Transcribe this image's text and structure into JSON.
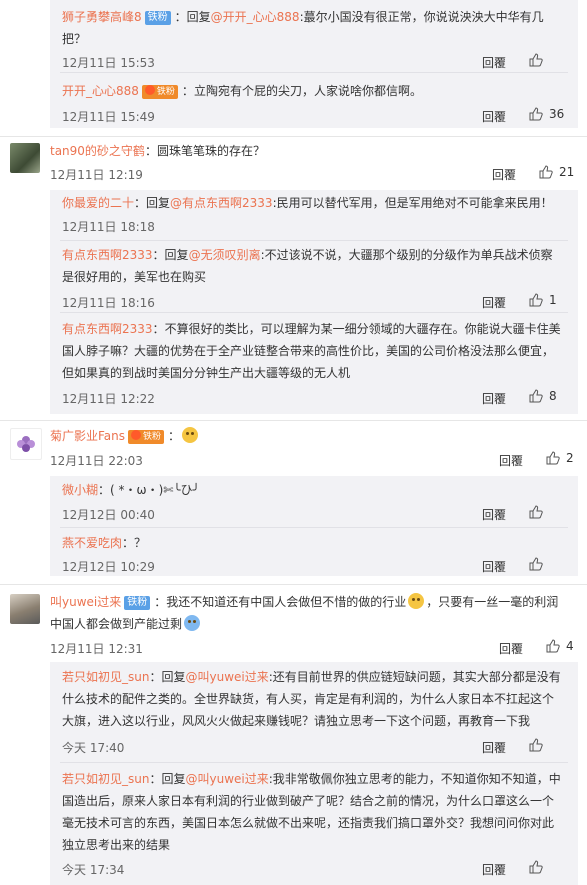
{
  "ui": {
    "reply_label": "回覆",
    "like_icon": "thumbs-up-icon"
  },
  "threads": [
    {
      "replies": [
        {
          "user": "狮子勇攀高峰8",
          "badge": "铁粉",
          "prefix": "：回复",
          "mention": "@开开_心心888",
          "text": ":蕞尔小国没有很正常，你说说泱泱大中华有几把？",
          "time": "12月11日 15:53",
          "likes": ""
        },
        {
          "user": "开开_心心888",
          "badge": "铁粉",
          "prefix": "：",
          "mention": "",
          "text": "立陶宛有个屁的尖刀，人家说啥你都信啊。",
          "time": "12月11日 15:49",
          "likes": "36"
        }
      ]
    },
    {
      "main": {
        "user": "tan90的砂之守鹤",
        "text": "：圆珠笔笔珠的存在？",
        "time": "12月11日 12:19",
        "likes": "21"
      },
      "replies": [
        {
          "user": "你最爱的二十",
          "prefix": "：回复",
          "mention": "@有点东西啊2333",
          "text": ":民用可以替代军用，但是军用绝对不可能拿来民用！",
          "time": "12月11日 18:18",
          "likes": ""
        },
        {
          "user": "有点东西啊2333",
          "prefix": "：回复",
          "mention": "@无须叹别离",
          "text": ":不过该说不说，大疆那个级别的分级作为单兵战术侦察是很好用的，美军也在购买",
          "time": "12月11日 18:16",
          "likes": "1"
        },
        {
          "user": "有点东西啊2333",
          "prefix": "：",
          "mention": "",
          "text": "不算很好的类比，可以理解为某一细分领域的大疆存在。你能说大疆卡住美国人脖子嘛？大疆的优势在于全产业链整合带来的高性价比，美国的公司价格没法那么便宜，但如果真的到战时美国分分钟生产出大疆等级的无人机",
          "time": "12月11日 12:22",
          "likes": "8"
        }
      ]
    },
    {
      "main": {
        "user": "菊广影业Fans",
        "badge": "铁粉",
        "text": "：",
        "time": "12月11日 22:03",
        "likes": "2"
      },
      "replies": [
        {
          "user": "微小糊",
          "prefix": "：",
          "mention": "",
          "text": "( *・ω・)✄╰ひ╯",
          "time": "12月12日 00:40",
          "likes": ""
        },
        {
          "user": "燕不爱吃肉",
          "prefix": "：",
          "mention": "",
          "text": "？",
          "time": "12月12日 10:29",
          "likes": ""
        }
      ]
    },
    {
      "main": {
        "user": "叫yuwei过来",
        "badge": "铁粉",
        "text_a": "：我还不知道还有中国人会做但不惜的做的行业",
        "text_b": "，只要有一丝一毫的利润中国人都会做到产能过剩",
        "time": "12月11日 12:31",
        "likes": "4"
      },
      "replies": [
        {
          "user": "若只如初见_sun",
          "prefix": "：回复",
          "mention": "@叫yuwei过来",
          "text": ":还有目前世界的供应链短缺问题，其实大部分都是没有什么技术的配件之类的。全世界缺货，有人买，肯定是有利润的，为什么人家日本不扛起这个大旗，进入这以行业，风风火火做起来赚钱呢？请独立思考一下这个问题，再教育一下我",
          "time": "今天 17:40",
          "likes": ""
        },
        {
          "user": "若只如初见_sun",
          "prefix": "：回复",
          "mention": "@叫yuwei过来",
          "text": ":我非常敬佩你独立思考的能力，不知道你知不知道，中国造出后，原来人家日本有利润的行业做到破产了呢？结合之前的情况，为什么口罩这么一个毫无技术可言的东西，美国日本怎么就做不出来呢，还指责我们搞口罩外交？我想问问你对此独立思考出来的结果",
          "time": "今天 17:34",
          "likes": ""
        }
      ]
    }
  ]
}
